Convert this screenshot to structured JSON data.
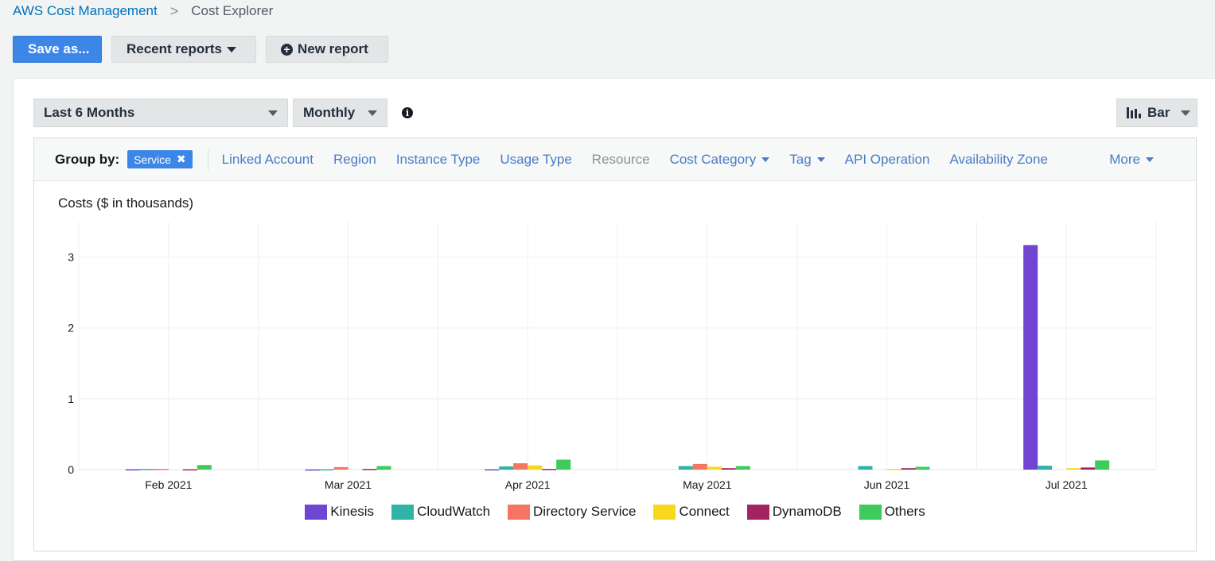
{
  "breadcrumb": {
    "root": "AWS Cost Management",
    "separator": ">",
    "current": "Cost Explorer"
  },
  "toolbar": {
    "save_label": "Save as...",
    "recent_label": "Recent reports",
    "new_label": "New report"
  },
  "controls": {
    "range_label": "Last 6 Months",
    "granularity_label": "Monthly",
    "chart_type_label": "Bar"
  },
  "groupby": {
    "label": "Group by:",
    "active_tag": "Service",
    "remove_glyph": "✖",
    "options": [
      {
        "label": "Linked Account",
        "enabled": true,
        "dropdown": false
      },
      {
        "label": "Region",
        "enabled": true,
        "dropdown": false
      },
      {
        "label": "Instance Type",
        "enabled": true,
        "dropdown": false
      },
      {
        "label": "Usage Type",
        "enabled": true,
        "dropdown": false
      },
      {
        "label": "Resource",
        "enabled": false,
        "dropdown": false
      },
      {
        "label": "Cost Category",
        "enabled": true,
        "dropdown": true
      },
      {
        "label": "Tag",
        "enabled": true,
        "dropdown": true
      },
      {
        "label": "API Operation",
        "enabled": true,
        "dropdown": false
      },
      {
        "label": "Availability Zone",
        "enabled": true,
        "dropdown": false
      }
    ],
    "more_label": "More"
  },
  "chart_data": {
    "type": "bar",
    "ylabel": "Costs ($ in thousands)",
    "ylim": [
      0,
      3.5
    ],
    "yticks": [
      0,
      1,
      2,
      3
    ],
    "categories": [
      "Feb 2021",
      "Mar 2021",
      "Apr 2021",
      "May 2021",
      "Jun 2021",
      "Jul 2021"
    ],
    "grid": true,
    "legend_position": "bottom",
    "series": [
      {
        "name": "Kinesis",
        "color": "#6e46d1",
        "values": [
          0.005,
          0.003,
          0.005,
          0.0,
          0.0,
          3.17
        ]
      },
      {
        "name": "CloudWatch",
        "color": "#2eb3a6",
        "values": [
          0.01,
          0.005,
          0.045,
          0.05,
          0.05,
          0.055
        ]
      },
      {
        "name": "Directory Service",
        "color": "#f67562",
        "values": [
          0.01,
          0.035,
          0.09,
          0.08,
          0.0,
          0.0
        ]
      },
      {
        "name": "Connect",
        "color": "#f9d71c",
        "values": [
          0.0,
          0.0,
          0.06,
          0.04,
          0.01,
          0.02
        ]
      },
      {
        "name": "DynamoDB",
        "color": "#a32262",
        "values": [
          0.005,
          0.01,
          0.01,
          0.02,
          0.02,
          0.03
        ]
      },
      {
        "name": "Others",
        "color": "#3dcb5c",
        "values": [
          0.065,
          0.05,
          0.14,
          0.05,
          0.04,
          0.13
        ]
      }
    ]
  }
}
